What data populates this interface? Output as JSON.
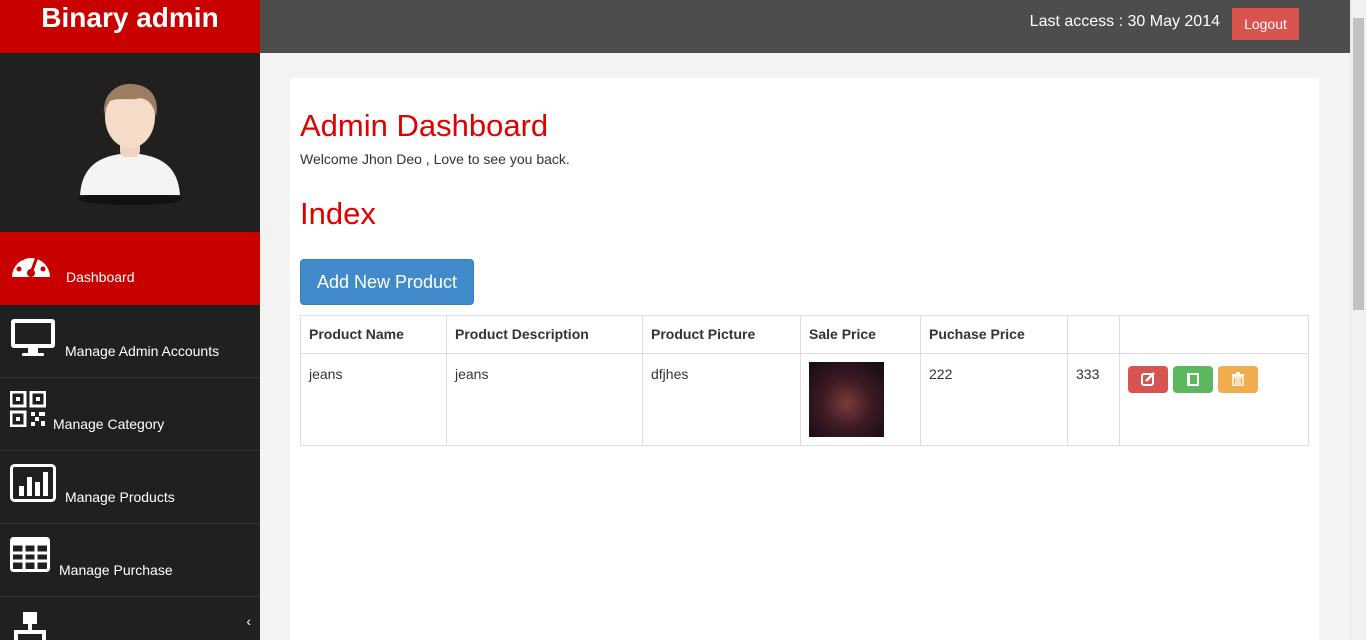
{
  "brand": "Binary admin",
  "header": {
    "last_access": "Last access : 30 May 2014",
    "logout_label": "Logout"
  },
  "sidebar": {
    "items": [
      {
        "label": "Dashboard",
        "icon": "dashboard-icon",
        "active": true
      },
      {
        "label": "Manage Admin Accounts",
        "icon": "desktop-icon"
      },
      {
        "label": "Manage Category",
        "icon": "qrcode-icon"
      },
      {
        "label": "Manage Products",
        "icon": "bar-chart-icon"
      },
      {
        "label": "Manage Purchase",
        "icon": "table-icon"
      },
      {
        "label": "",
        "icon": "sitemap-icon"
      }
    ]
  },
  "main": {
    "title": "Admin Dashboard",
    "welcome": "Welcome Jhon Deo , Love to see you back.",
    "section_title": "Index",
    "add_button": "Add New Product",
    "table": {
      "headers": [
        "Product Name",
        "Product Description",
        "Product Picture",
        "Sale Price",
        "Puchase Price",
        "",
        ""
      ],
      "rows": [
        {
          "name": "jeans",
          "description": "jeans",
          "picture": "dfjhes",
          "sale_price": "222",
          "purchase_price": "333"
        }
      ]
    }
  },
  "colors": {
    "brand_red": "#c90000",
    "topbar": "#4d4d4d",
    "sidebar": "#202020",
    "primary_button": "#428bca",
    "danger": "#d9534f",
    "success": "#5cb85c",
    "warning": "#f0ad4e"
  }
}
